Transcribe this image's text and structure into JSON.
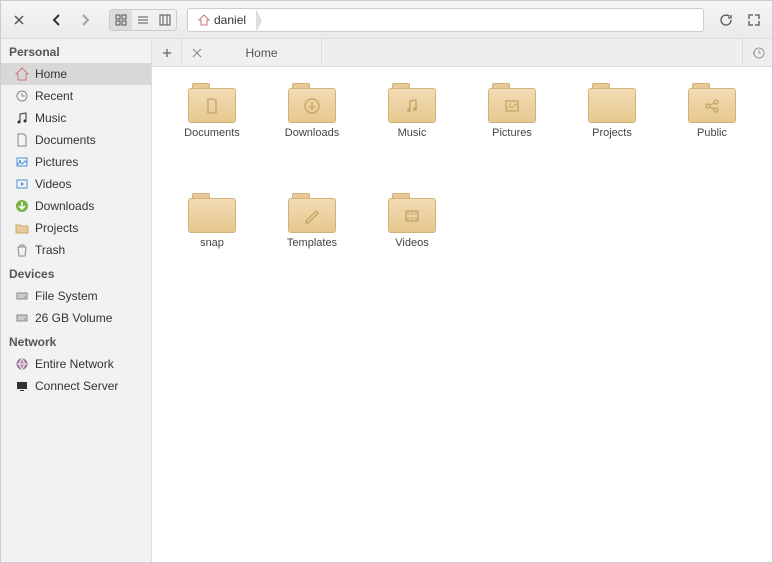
{
  "path": {
    "segment": "daniel"
  },
  "tab": {
    "label": "Home"
  },
  "sidebar": {
    "sections": [
      {
        "title": "Personal",
        "items": [
          {
            "label": "Home",
            "icon": "home",
            "selected": true
          },
          {
            "label": "Recent",
            "icon": "recent"
          },
          {
            "label": "Music",
            "icon": "music"
          },
          {
            "label": "Documents",
            "icon": "document"
          },
          {
            "label": "Pictures",
            "icon": "pictures"
          },
          {
            "label": "Videos",
            "icon": "videos"
          },
          {
            "label": "Downloads",
            "icon": "downloads"
          },
          {
            "label": "Projects",
            "icon": "folder"
          },
          {
            "label": "Trash",
            "icon": "trash"
          }
        ]
      },
      {
        "title": "Devices",
        "items": [
          {
            "label": "File System",
            "icon": "disk"
          },
          {
            "label": "26 GB Volume",
            "icon": "disk"
          }
        ]
      },
      {
        "title": "Network",
        "items": [
          {
            "label": "Entire Network",
            "icon": "network"
          },
          {
            "label": "Connect Server",
            "icon": "screen"
          }
        ]
      }
    ]
  },
  "folders": [
    {
      "name": "Documents",
      "icon": "document"
    },
    {
      "name": "Downloads",
      "icon": "download"
    },
    {
      "name": "Music",
      "icon": "music"
    },
    {
      "name": "Pictures",
      "icon": "picture"
    },
    {
      "name": "Projects",
      "icon": "folder"
    },
    {
      "name": "Public",
      "icon": "share"
    },
    {
      "name": "snap",
      "icon": "folder"
    },
    {
      "name": "Templates",
      "icon": "template"
    },
    {
      "name": "Videos",
      "icon": "video"
    }
  ]
}
